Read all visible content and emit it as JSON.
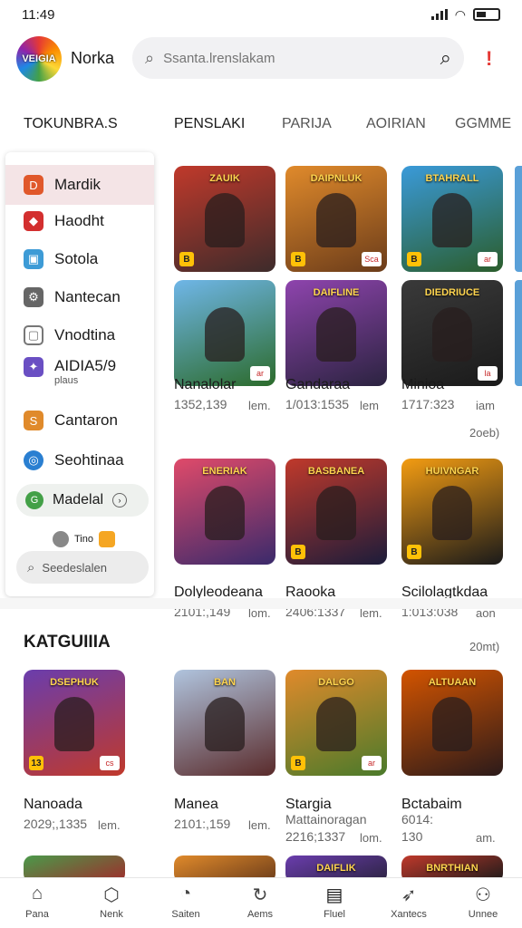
{
  "status_bar": {
    "time": "11:49",
    "battery_label": "",
    "network": "wifi"
  },
  "header": {
    "logo_text": "VEIGIA",
    "app_name": "Norka",
    "search_placeholder": "Ssanta.lrenslakam",
    "search_icon": "search-icon",
    "alert_icon": "alert-icon"
  },
  "tabs": [
    "TOKUNBRA.S",
    "PENSLAKI",
    "PARIJA",
    "AOIRIAN",
    "GGMME"
  ],
  "sidebar": {
    "items": [
      {
        "label": "Mardik",
        "icon": "fire-icon",
        "color": "#e0582b",
        "active": true
      },
      {
        "label": "Haodht",
        "icon": "shield-icon",
        "color": "#d32f2f"
      },
      {
        "label": "Sotola",
        "icon": "layers-icon",
        "color": "#3d9bd6"
      },
      {
        "label": "Nantecan",
        "icon": "gear-icon",
        "color": "#666666"
      },
      {
        "label": "Vnodtina",
        "icon": "frame-icon",
        "color": "#777777"
      },
      {
        "label": "AIDIA5/9",
        "sub": "plaus",
        "icon": "sparkle-icon",
        "color": "#6a4fc3"
      },
      {
        "label": "Cantaron",
        "icon": "tag-icon",
        "color": "#e08a2b"
      },
      {
        "label": "Seohtinaa",
        "icon": "globe-icon",
        "color": "#2a7fd1"
      }
    ],
    "pill_label": "Madelal",
    "pill_icon": "game-icon",
    "mini_label": "Tino",
    "search_pill_label": "Seedeslalen"
  },
  "grid": {
    "row1": [
      {
        "title": "ZAUIK",
        "colors": [
          "#c0392b",
          "#3d2b2b"
        ],
        "badge": "B",
        "badge2": ""
      },
      {
        "title": "DAIPNLUK",
        "colors": [
          "#e08a2b",
          "#6b3c1a"
        ],
        "badge": "B",
        "badge2": "Sca"
      },
      {
        "title": "BTAHRALL",
        "colors": [
          "#3a9ad9",
          "#2b5d2b"
        ],
        "badge": "B",
        "badge2": "ar"
      }
    ],
    "row2": [
      {
        "title": "",
        "colors": [
          "#6fb6e8",
          "#2c6b2b"
        ],
        "badge": "",
        "badge2": "ar",
        "name": "Nanalolar",
        "stat": "1352,139",
        "unit": "lem."
      },
      {
        "title": "DAIFLINE",
        "colors": [
          "#8e44ad",
          "#2b2340"
        ],
        "badge": "",
        "badge2": "",
        "name": "Gandaraa",
        "stat": "1/013:1535",
        "unit": "lem"
      },
      {
        "title": "DIEDRIUCE",
        "colors": [
          "#3a3a3a",
          "#1a1a1a"
        ],
        "badge": "",
        "badge2": "la",
        "name": "Minioa",
        "stat": "1717:323",
        "unit": "iam"
      }
    ],
    "row2_extra": "2oeb)",
    "row3": [
      {
        "title": "ENERIAK",
        "colors": [
          "#e04a6a",
          "#3a2a6b"
        ],
        "badge": "",
        "badge2": "",
        "name": "Dolyleodeana",
        "stat": "2101:,149",
        "unit": "lom."
      },
      {
        "title": "BASBANEA",
        "colors": [
          "#c0392b",
          "#1c1c3a"
        ],
        "badge": "B",
        "badge2": "",
        "name": "Raooka",
        "stat": "2406:1337",
        "unit": "lem."
      },
      {
        "title": "HUIVNGAR",
        "colors": [
          "#f39c12",
          "#1a1a1a"
        ],
        "badge": "B",
        "badge2": "",
        "name": "Scilolagtkdaa",
        "stat": "1:013:038",
        "unit": "aon"
      }
    ],
    "row3_extra": "20mt)",
    "row4": [
      {
        "title": "DSEPHUK",
        "colors": [
          "#6a3dad",
          "#c0392b"
        ],
        "badge": "13",
        "badge2": "cs",
        "name": "Nanoada",
        "stat": "2029;,1335",
        "unit": "lem."
      },
      {
        "title": "BAN",
        "colors": [
          "#b0c4de",
          "#5a2b2b"
        ],
        "badge": "",
        "badge2": "",
        "name": "Manea",
        "stat": "2101:,159",
        "unit": "lem."
      },
      {
        "title": "DALGO",
        "colors": [
          "#e08a2b",
          "#4a7a2b"
        ],
        "badge": "B",
        "badge2": "ar",
        "name": "Stargia",
        "sub": "Mattainoragan",
        "stat": "2216;1337",
        "unit": "lom."
      },
      {
        "title": "ALTUAAN",
        "colors": [
          "#d35400",
          "#2b1a1a"
        ],
        "badge": "",
        "badge2": "",
        "name": "Bctabaim",
        "sub": "6014:",
        "stat": "130",
        "unit": "am."
      }
    ],
    "row5": [
      {
        "title": "",
        "colors": [
          "#4a9a4a",
          "#a02b2b"
        ]
      },
      {
        "title": "",
        "colors": [
          "#e08a2b",
          "#6b3c1a"
        ]
      },
      {
        "title": "DAIFLIK",
        "colors": [
          "#6a3dad",
          "#2b2340"
        ]
      },
      {
        "title": "BNRTHIAN",
        "colors": [
          "#c0392b",
          "#1a1a1a"
        ]
      }
    ]
  },
  "section_title": "KATGUIIIA",
  "bottom_nav": [
    {
      "label": "Pana",
      "icon": "home-icon"
    },
    {
      "label": "Nenk",
      "icon": "cube-icon"
    },
    {
      "label": "Saiten",
      "icon": "compass-icon"
    },
    {
      "label": "Aems",
      "icon": "refresh-icon"
    },
    {
      "label": "Fluel",
      "icon": "wallet-icon"
    },
    {
      "label": "Xantecs",
      "icon": "rocket-icon"
    },
    {
      "label": "Unnee",
      "icon": "user-icon"
    }
  ]
}
